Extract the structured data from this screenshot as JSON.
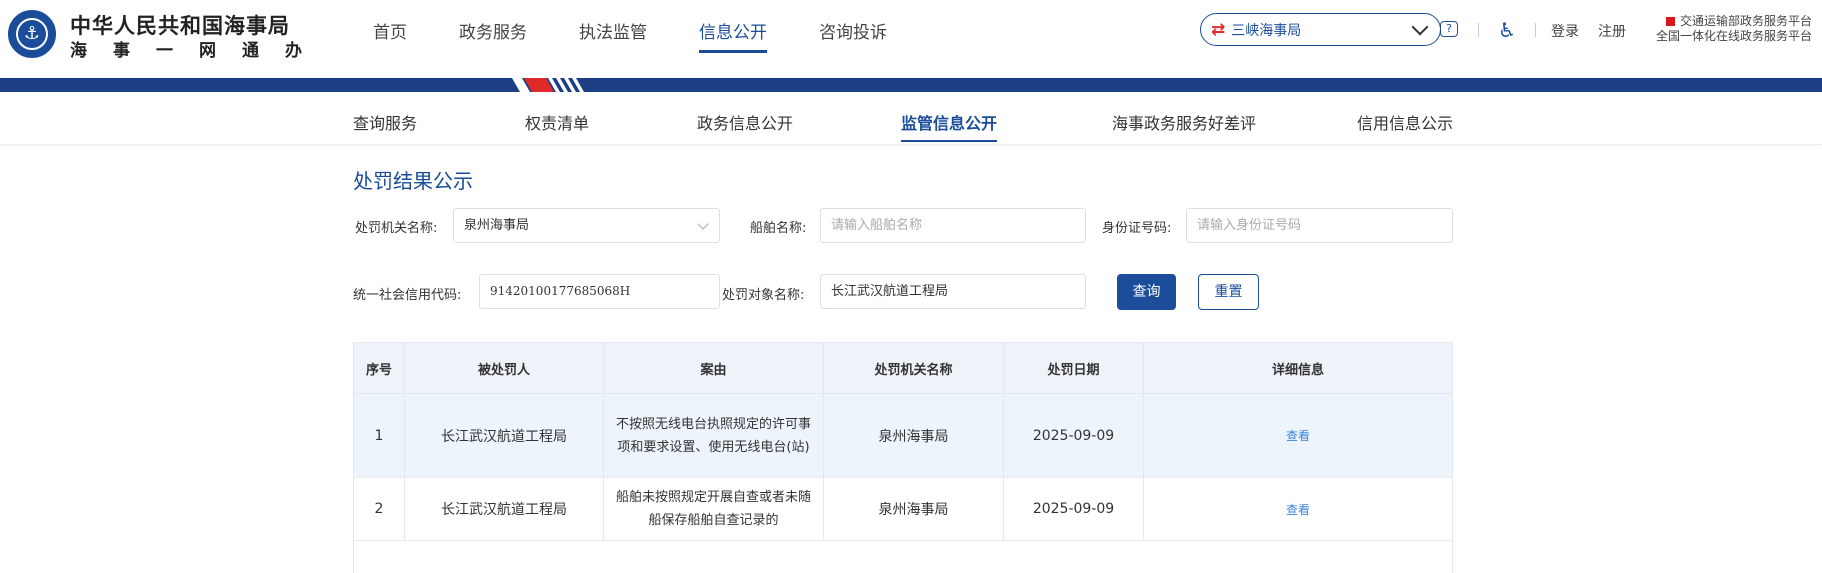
{
  "header": {
    "brand_title": "中华人民共和国海事局",
    "brand_sub": "海事一网通办",
    "nav": [
      {
        "label": "首页"
      },
      {
        "label": "政务服务"
      },
      {
        "label": "执法监管"
      },
      {
        "label": "信息公开",
        "active": true
      },
      {
        "label": "咨询投诉"
      }
    ],
    "bureau_select": "三峡海事局",
    "help_icon": "question-icon",
    "accessibility_icon": "wheelchair-icon",
    "login": "登录",
    "register": "注册",
    "platform_line1": "交通运输部政务服务平台",
    "platform_line2": "全国一体化在线政务服务平台"
  },
  "subnav": [
    {
      "label": "查询服务"
    },
    {
      "label": "权责清单"
    },
    {
      "label": "政务信息公开"
    },
    {
      "label": "监管信息公开",
      "active": true
    },
    {
      "label": "海事政务服务好差评"
    },
    {
      "label": "信用信息公示"
    }
  ],
  "page_title": "处罚结果公示",
  "form": {
    "org_label": "处罚机关名称:",
    "org_value": "泉州海事局",
    "ship_label": "船舶名称:",
    "ship_placeholder": "请输入船舶名称",
    "id_label": "身份证号码:",
    "id_placeholder": "请输入身份证号码",
    "credit_label": "统一社会信用代码:",
    "credit_value": "91420100177685068H",
    "target_label": "处罚对象名称:",
    "target_value": "长江武汉航道工程局",
    "query_label": "查询",
    "reset_label": "重置"
  },
  "table": {
    "headers": [
      "序号",
      "被处罚人",
      "案由",
      "处罚机关名称",
      "处罚日期",
      "详细信息"
    ],
    "rows": [
      {
        "no": "1",
        "person": "长江武汉航道工程局",
        "reason": "不按照无线电台执照规定的许可事项和要求设置、使用无线电台(站)",
        "org": "泉州海事局",
        "date": "2025-09-09",
        "action": "查看"
      },
      {
        "no": "2",
        "person": "长江武汉航道工程局",
        "reason": "船舶未按照规定开展自查或者未随船保存船舶自查记录的",
        "org": "泉州海事局",
        "date": "2025-09-09",
        "action": "查看"
      }
    ]
  },
  "colors": {
    "primary": "#1b4d9b",
    "band": "#1b3e85",
    "accent_red": "#e02a2a",
    "link": "#3a86d9",
    "row_highlight": "#eef4fc"
  }
}
